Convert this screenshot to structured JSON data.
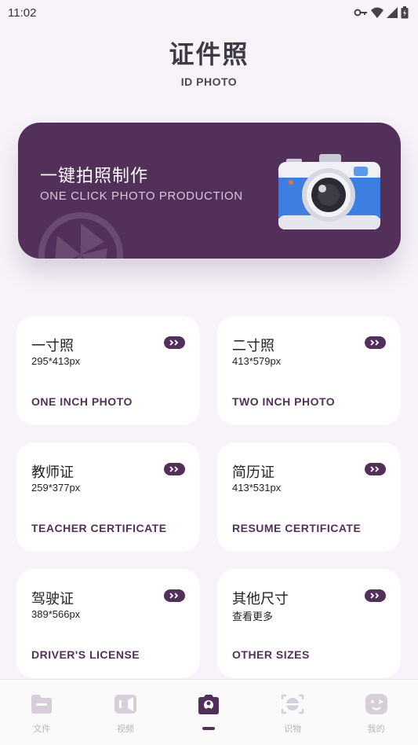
{
  "status_bar": {
    "time": "11:02",
    "icons": [
      "key-icon",
      "wifi-icon",
      "signal-icon",
      "battery-icon"
    ]
  },
  "header": {
    "title": "证件照",
    "subtitle": "ID PHOTO"
  },
  "banner": {
    "title": "一键拍照制作",
    "subtitle": "ONE CLICK PHOTO PRODUCTION"
  },
  "cards": [
    {
      "title": "一寸照",
      "size": "295*413px",
      "en": "ONE INCH PHOTO"
    },
    {
      "title": "二寸照",
      "size": "413*579px",
      "en": "TWO INCH PHOTO"
    },
    {
      "title": "教师证",
      "size": "259*377px",
      "en": "TEACHER CERTIFICATE"
    },
    {
      "title": "简历证",
      "size": "413*531px",
      "en": "RESUME CERTIFICATE"
    },
    {
      "title": "驾驶证",
      "size": "389*566px",
      "en": "DRIVER'S LICENSE"
    },
    {
      "title": "其他尺寸",
      "size": "查看更多",
      "en": "OTHER SIZES"
    }
  ],
  "bottom_nav": {
    "items": [
      {
        "label": "文件",
        "icon": "folder-icon"
      },
      {
        "label": "视频",
        "icon": "video-icon"
      },
      {
        "label": "",
        "icon": "camera-icon",
        "active": true
      },
      {
        "label": "识物",
        "icon": "scan-icon"
      },
      {
        "label": "我的",
        "icon": "profile-icon"
      }
    ]
  },
  "colors": {
    "accent": "#53305a",
    "background": "#f7f3f9",
    "nav_inactive": "#d6cfd9"
  }
}
